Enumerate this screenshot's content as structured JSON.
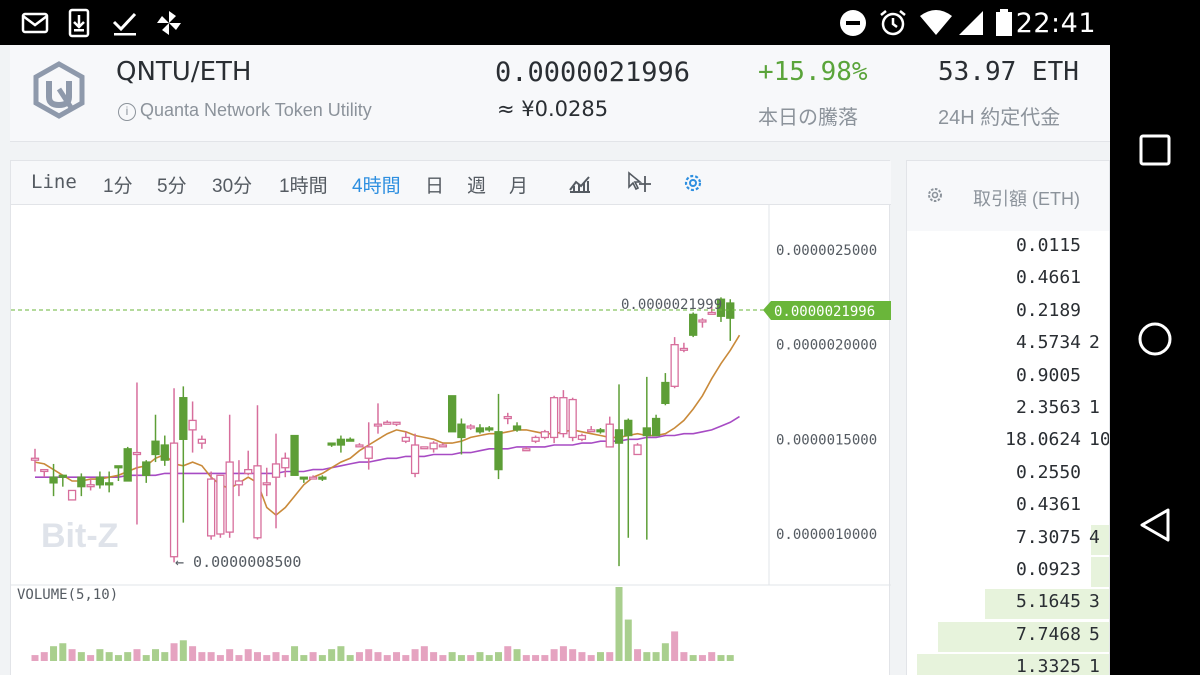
{
  "status_bar": {
    "time": "22:41"
  },
  "header": {
    "pair": "QNTU/ETH",
    "token_name": "Quanta Network Token Utility",
    "info_glyph": "i",
    "price": "0.0000021996",
    "price_local": "≈ ¥0.0285",
    "change": "+15.98%",
    "change_label": "本日の騰落",
    "volume": "53.97 ETH",
    "volume_label": "24H 約定代金"
  },
  "chart_toolbar": {
    "timeframes": [
      "Line",
      "1分",
      "5分",
      "30分",
      "1時間",
      "4時間",
      "日",
      "週",
      "月"
    ],
    "active": "4時間"
  },
  "chart": {
    "watermark": "Bit-Z",
    "last_price_label": "0.0000021996",
    "last_price_ref": "0.0000021999",
    "low_marker": "← 0.0000008500",
    "volume_label": "VOLUME(5,10)",
    "y_ticks": [
      "0.0000025000",
      "0.0000020000",
      "0.0000015000",
      "0.0000010000"
    ],
    "colors": {
      "up": "#5d9e36",
      "down": "#d76e9c",
      "ma1": "#c98a3a",
      "ma2": "#a74bc4",
      "price_line": "#6ab63a"
    }
  },
  "chart_data": {
    "type": "candlestick",
    "ylim": [
      5e-07,
      2.8e-06
    ],
    "y_ticks": [
      2.5e-06,
      2e-06,
      1.5e-06,
      1e-06
    ],
    "candles": [
      {
        "o": 1.39,
        "c": 1.4,
        "h": 1.45,
        "l": 1.33,
        "up": false,
        "v": 2
      },
      {
        "o": 1.34,
        "c": 1.34,
        "h": 1.34,
        "l": 1.3,
        "up": false,
        "v": 3
      },
      {
        "o": 1.27,
        "c": 1.3,
        "h": 1.37,
        "l": 1.2,
        "up": true,
        "v": 5
      },
      {
        "o": 1.31,
        "c": 1.3,
        "h": 1.31,
        "l": 1.25,
        "up": true,
        "v": 6
      },
      {
        "o": 1.18,
        "c": 1.23,
        "h": 1.23,
        "l": 1.18,
        "up": false,
        "v": 4
      },
      {
        "o": 1.25,
        "c": 1.3,
        "h": 1.32,
        "l": 1.2,
        "up": true,
        "v": 3
      },
      {
        "o": 1.26,
        "c": 1.25,
        "h": 1.29,
        "l": 1.23,
        "up": false,
        "v": 2
      },
      {
        "o": 1.26,
        "c": 1.3,
        "h": 1.33,
        "l": 1.24,
        "up": true,
        "v": 4
      },
      {
        "o": 1.26,
        "c": 1.27,
        "h": 1.33,
        "l": 1.22,
        "up": true,
        "v": 3
      },
      {
        "o": 1.35,
        "c": 1.36,
        "h": 1.36,
        "l": 1.28,
        "up": true,
        "v": 2
      },
      {
        "o": 1.28,
        "c": 1.45,
        "h": 1.46,
        "l": 1.28,
        "up": true,
        "v": 3
      },
      {
        "o": 1.42,
        "c": 1.43,
        "h": 1.8,
        "l": 1.05,
        "up": false,
        "v": 4
      },
      {
        "o": 1.31,
        "c": 1.38,
        "h": 1.39,
        "l": 1.27,
        "up": true,
        "v": 2
      },
      {
        "o": 1.42,
        "c": 1.49,
        "h": 1.63,
        "l": 1.38,
        "up": true,
        "v": 4
      },
      {
        "o": 1.39,
        "c": 1.47,
        "h": 1.52,
        "l": 1.36,
        "up": true,
        "v": 3
      },
      {
        "o": 1.48,
        "c": 0.88,
        "h": 1.77,
        "l": 0.85,
        "up": false,
        "v": 6
      },
      {
        "o": 1.5,
        "c": 1.72,
        "h": 1.78,
        "l": 1.06,
        "up": true,
        "v": 7
      },
      {
        "o": 1.6,
        "c": 1.55,
        "h": 1.7,
        "l": 1.43,
        "up": false,
        "v": 5
      },
      {
        "o": 1.5,
        "c": 1.48,
        "h": 1.52,
        "l": 1.45,
        "up": false,
        "v": 3
      },
      {
        "o": 1.29,
        "c": 0.99,
        "h": 1.33,
        "l": 0.97,
        "up": false,
        "v": 3
      },
      {
        "o": 1.31,
        "c": 1.0,
        "h": 1.31,
        "l": 0.98,
        "up": false,
        "v": 2
      },
      {
        "o": 1.38,
        "c": 1.01,
        "h": 1.63,
        "l": 0.98,
        "up": false,
        "v": 4
      },
      {
        "o": 1.28,
        "c": 1.26,
        "h": 1.39,
        "l": 1.2,
        "up": false,
        "v": 2
      },
      {
        "o": 1.32,
        "c": 1.34,
        "h": 1.44,
        "l": 1.31,
        "up": false,
        "v": 4
      },
      {
        "o": 1.36,
        "c": 0.98,
        "h": 1.68,
        "l": 0.97,
        "up": false,
        "v": 3
      },
      {
        "o": 1.27,
        "c": 1.27,
        "h": 1.35,
        "l": 1.2,
        "up": false,
        "v": 2
      },
      {
        "o": 1.3,
        "c": 1.37,
        "h": 1.53,
        "l": 1.03,
        "up": false,
        "v": 3
      },
      {
        "o": 1.35,
        "c": 1.4,
        "h": 1.43,
        "l": 1.3,
        "up": false,
        "v": 2
      },
      {
        "o": 1.31,
        "c": 1.52,
        "h": 1.52,
        "l": 1.31,
        "up": true,
        "v": 5
      },
      {
        "o": 1.3,
        "c": 1.3,
        "h": 1.3,
        "l": 1.27,
        "up": true,
        "v": 2
      },
      {
        "o": 1.3,
        "c": 1.3,
        "h": 1.31,
        "l": 1.29,
        "up": false,
        "v": 3
      },
      {
        "o": 1.3,
        "c": 1.29,
        "h": 1.31,
        "l": 1.28,
        "up": true,
        "v": 2
      },
      {
        "o": 1.47,
        "c": 1.48,
        "h": 1.48,
        "l": 1.46,
        "up": true,
        "v": 4
      },
      {
        "o": 1.5,
        "c": 1.47,
        "h": 1.52,
        "l": 1.43,
        "up": true,
        "v": 5
      },
      {
        "o": 1.5,
        "c": 1.5,
        "h": 1.51,
        "l": 1.5,
        "up": true,
        "v": 2
      },
      {
        "o": 1.47,
        "c": 1.47,
        "h": 1.48,
        "l": 1.46,
        "up": false,
        "v": 3
      },
      {
        "o": 1.4,
        "c": 1.46,
        "h": 1.59,
        "l": 1.34,
        "up": false,
        "v": 4
      },
      {
        "o": 1.58,
        "c": 1.58,
        "h": 1.69,
        "l": 1.53,
        "up": false,
        "v": 3
      },
      {
        "o": 1.58,
        "c": 1.59,
        "h": 1.6,
        "l": 1.58,
        "up": false,
        "v": 2
      },
      {
        "o": 1.59,
        "c": 1.58,
        "h": 1.59,
        "l": 1.57,
        "up": false,
        "v": 3
      },
      {
        "o": 1.51,
        "c": 1.49,
        "h": 1.54,
        "l": 1.48,
        "up": false,
        "v": 2
      },
      {
        "o": 1.47,
        "c": 1.32,
        "h": 1.53,
        "l": 1.3,
        "up": false,
        "v": 4
      },
      {
        "o": 1.46,
        "c": 1.46,
        "h": 1.46,
        "l": 1.45,
        "up": false,
        "v": 5
      },
      {
        "o": 1.48,
        "c": 1.45,
        "h": 1.49,
        "l": 1.43,
        "up": false,
        "v": 3
      },
      {
        "o": 1.47,
        "c": 1.47,
        "h": 1.48,
        "l": 1.46,
        "up": false,
        "v": 2
      },
      {
        "o": 1.54,
        "c": 1.73,
        "h": 1.73,
        "l": 1.54,
        "up": true,
        "v": 3
      },
      {
        "o": 1.51,
        "c": 1.58,
        "h": 1.61,
        "l": 1.42,
        "up": true,
        "v": 2
      },
      {
        "o": 1.56,
        "c": 1.57,
        "h": 1.58,
        "l": 1.55,
        "up": false,
        "v": 2
      },
      {
        "o": 1.54,
        "c": 1.56,
        "h": 1.58,
        "l": 1.53,
        "up": true,
        "v": 3
      },
      {
        "o": 1.55,
        "c": 1.56,
        "h": 1.57,
        "l": 1.54,
        "up": true,
        "v": 2
      },
      {
        "o": 1.54,
        "c": 1.34,
        "h": 1.74,
        "l": 1.29,
        "up": true,
        "v": 3
      },
      {
        "o": 1.62,
        "c": 1.61,
        "h": 1.64,
        "l": 1.58,
        "up": false,
        "v": 5
      },
      {
        "o": 1.55,
        "c": 1.57,
        "h": 1.59,
        "l": 1.54,
        "up": true,
        "v": 4
      },
      {
        "o": 1.44,
        "c": 1.45,
        "h": 1.46,
        "l": 1.44,
        "up": false,
        "v": 2
      },
      {
        "o": 1.49,
        "c": 1.51,
        "h": 1.52,
        "l": 1.48,
        "up": false,
        "v": 2
      },
      {
        "o": 1.51,
        "c": 1.54,
        "h": 1.55,
        "l": 1.5,
        "up": false,
        "v": 2
      },
      {
        "o": 1.51,
        "c": 1.72,
        "h": 1.73,
        "l": 1.48,
        "up": false,
        "v": 4
      },
      {
        "o": 1.72,
        "c": 1.53,
        "h": 1.76,
        "l": 1.51,
        "up": false,
        "v": 5
      },
      {
        "o": 1.71,
        "c": 1.51,
        "h": 1.72,
        "l": 1.49,
        "up": false,
        "v": 4
      },
      {
        "o": 1.52,
        "c": 1.5,
        "h": 1.53,
        "l": 1.49,
        "up": false,
        "v": 3
      },
      {
        "o": 1.55,
        "c": 1.55,
        "h": 1.57,
        "l": 1.54,
        "up": false,
        "v": 2
      },
      {
        "o": 1.54,
        "c": 1.55,
        "h": 1.56,
        "l": 1.53,
        "up": true,
        "v": 3
      },
      {
        "o": 1.46,
        "c": 1.58,
        "h": 1.62,
        "l": 1.46,
        "up": false,
        "v": 3
      },
      {
        "o": 1.48,
        "c": 1.55,
        "h": 1.79,
        "l": 0.83,
        "up": true,
        "v": 25
      },
      {
        "o": 1.52,
        "c": 1.6,
        "h": 1.61,
        "l": 0.98,
        "up": true,
        "v": 14
      },
      {
        "o": 1.42,
        "c": 1.47,
        "h": 1.48,
        "l": 1.42,
        "up": false,
        "v": 4
      },
      {
        "o": 1.52,
        "c": 1.56,
        "h": 1.83,
        "l": 0.97,
        "up": true,
        "v": 3
      },
      {
        "o": 1.52,
        "c": 1.61,
        "h": 1.63,
        "l": 1.52,
        "up": true,
        "v": 3
      },
      {
        "o": 1.69,
        "c": 1.8,
        "h": 1.85,
        "l": 1.68,
        "up": true,
        "v": 6
      },
      {
        "o": 1.78,
        "c": 2.0,
        "h": 2.04,
        "l": 1.77,
        "up": false,
        "v": 10
      },
      {
        "o": 1.98,
        "c": 1.98,
        "h": 2.01,
        "l": 1.96,
        "up": false,
        "v": 3
      },
      {
        "o": 2.05,
        "c": 2.16,
        "h": 2.17,
        "l": 2.04,
        "up": true,
        "v": 2
      },
      {
        "o": 2.13,
        "c": 2.12,
        "h": 2.14,
        "l": 2.09,
        "up": false,
        "v": 2
      },
      {
        "o": 2.17,
        "c": 2.17,
        "h": 2.2,
        "l": 2.16,
        "up": false,
        "v": 3
      },
      {
        "o": 2.15,
        "c": 2.24,
        "h": 2.25,
        "l": 2.12,
        "up": true,
        "v": 2
      },
      {
        "o": 2.14,
        "c": 2.22,
        "h": 2.24,
        "l": 2.02,
        "up": true,
        "v": 2
      }
    ],
    "ma1": [
      1.38,
      1.37,
      1.34,
      1.31,
      1.28,
      1.28,
      1.29,
      1.29,
      1.3,
      1.31,
      1.33,
      1.35,
      1.36,
      1.4,
      1.42,
      1.37,
      1.36,
      1.38,
      1.36,
      1.3,
      1.26,
      1.24,
      1.27,
      1.3,
      1.27,
      1.14,
      1.1,
      1.14,
      1.2,
      1.26,
      1.3,
      1.32,
      1.35,
      1.38,
      1.4,
      1.44,
      1.47,
      1.5,
      1.53,
      1.55,
      1.54,
      1.52,
      1.51,
      1.5,
      1.48,
      1.48,
      1.49,
      1.51,
      1.52,
      1.53,
      1.53,
      1.54,
      1.55,
      1.55,
      1.54,
      1.53,
      1.53,
      1.54,
      1.55,
      1.54,
      1.53,
      1.52,
      1.51,
      1.51,
      1.52,
      1.53,
      1.52,
      1.52,
      1.53,
      1.56,
      1.6,
      1.66,
      1.73,
      1.82,
      1.9,
      1.97,
      2.05
    ],
    "ma2": [
      1.3,
      1.3,
      1.3,
      1.3,
      1.3,
      1.3,
      1.3,
      1.3,
      1.3,
      1.3,
      1.31,
      1.31,
      1.31,
      1.31,
      1.32,
      1.32,
      1.32,
      1.32,
      1.32,
      1.32,
      1.32,
      1.32,
      1.32,
      1.32,
      1.32,
      1.32,
      1.32,
      1.33,
      1.33,
      1.33,
      1.34,
      1.34,
      1.35,
      1.36,
      1.37,
      1.38,
      1.38,
      1.39,
      1.4,
      1.4,
      1.41,
      1.41,
      1.41,
      1.42,
      1.42,
      1.42,
      1.43,
      1.43,
      1.44,
      1.45,
      1.45,
      1.45,
      1.46,
      1.46,
      1.46,
      1.46,
      1.47,
      1.47,
      1.47,
      1.48,
      1.48,
      1.49,
      1.49,
      1.49,
      1.5,
      1.5,
      1.51,
      1.51,
      1.52,
      1.52,
      1.53,
      1.53,
      1.54,
      1.55,
      1.57,
      1.59,
      1.62
    ]
  },
  "order_book": {
    "header": "取引額 (ETH)",
    "rows": [
      {
        "amount": "0.0115",
        "cut": "",
        "depth": 0
      },
      {
        "amount": "0.4661",
        "cut": "",
        "depth": 0
      },
      {
        "amount": "0.2189",
        "cut": "",
        "depth": 0
      },
      {
        "amount": "4.5734",
        "cut": "2",
        "depth": 0
      },
      {
        "amount": "0.9005",
        "cut": "",
        "depth": 0
      },
      {
        "amount": "2.3563",
        "cut": "1",
        "depth": 0
      },
      {
        "amount": "18.0624",
        "cut": "10",
        "depth": 0
      },
      {
        "amount": "0.2550",
        "cut": "",
        "depth": 0
      },
      {
        "amount": "0.4361",
        "cut": "",
        "depth": 0
      },
      {
        "amount": "7.3075",
        "cut": "4",
        "depth": 0.1
      },
      {
        "amount": "0.0923",
        "cut": "",
        "depth": 0.1
      },
      {
        "amount": "5.1645",
        "cut": "3",
        "depth": 0.62
      },
      {
        "amount": "7.7468",
        "cut": "5",
        "depth": 0.85
      },
      {
        "amount": "1.3325",
        "cut": "1",
        "depth": 0.95
      }
    ]
  }
}
